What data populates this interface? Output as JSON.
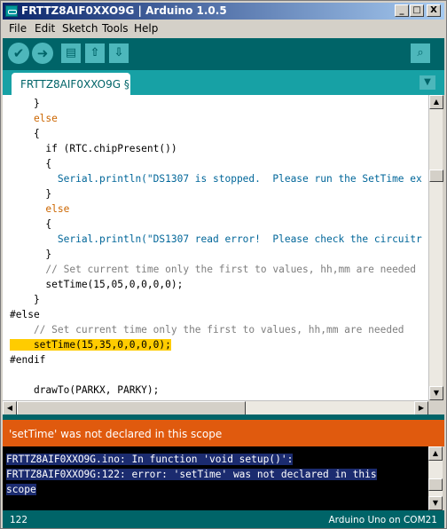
{
  "window": {
    "title": "FRTTZ8AIF0XXO9G | Arduino 1.0.5",
    "minimize": "_",
    "maximize": "□",
    "close": "X"
  },
  "menu": [
    "File",
    "Edit",
    "Sketch",
    "Tools",
    "Help"
  ],
  "toolbar": {
    "verify_icon": "check-icon",
    "upload_icon": "arrow-right-icon",
    "new_icon": "document-icon",
    "open_icon": "arrow-up-icon",
    "save_icon": "arrow-down-icon",
    "serial_icon": "magnifier-icon"
  },
  "tab": {
    "label": "FRTTZ8AIF0XXO9G §"
  },
  "editor": {
    "lines": [
      "    }",
      "    else",
      "    {",
      "      if (RTC.chipPresent())",
      "      {",
      "        Serial.println(\"DS1307 is stopped.  Please run the SetTime ex",
      "      }",
      "      else",
      "      {",
      "        Serial.println(\"DS1307 read error!  Please check the circuitr",
      "      }",
      "      // Set current time only the first to values, hh,mm are needed",
      "      setTime(15,05,0,0,0,0);",
      "    }",
      "#else",
      "    // Set current time only the first to values, hh,mm are needed",
      "    setTime(15,35,0,0,0,0);",
      "#endif",
      "",
      "    drawTo(PARKX, PARKY);"
    ]
  },
  "status": {
    "message": "'setTime' was not declared in this scope"
  },
  "console": {
    "lines": [
      "FRTTZ8AIF0XXO9G.ino: In function 'void setup()':",
      "FRTTZ8AIF0XXO9G:122: error: 'setTime' was not declared in this",
      "scope"
    ]
  },
  "footer": {
    "line_number": "122",
    "board": "Arduino Uno on COM21"
  },
  "colors": {
    "toolbar": "#006468",
    "tabbar": "#17a1a5",
    "error_bar": "#e05a0e",
    "highlight": "#ffcc00"
  }
}
